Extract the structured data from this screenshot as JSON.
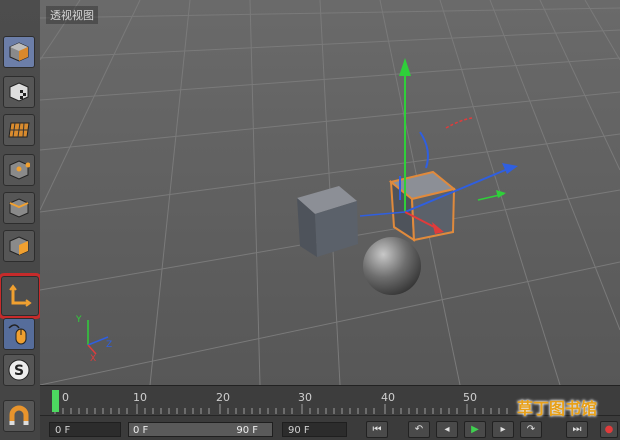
{
  "viewport": {
    "title": "透视视图"
  },
  "timeline": {
    "ticks": [
      "0",
      "10",
      "20",
      "30",
      "40",
      "50"
    ]
  },
  "controls": {
    "start_frame": "0 F",
    "range_start": "0 F",
    "range_end": "90 F",
    "end_frame": "90 F"
  },
  "gizmo": {
    "x_label": "X",
    "y_label": "Y",
    "z_label": "Z"
  },
  "watermark": {
    "text": "草丁图书馆"
  },
  "colors": {
    "selection": "#e08a3c",
    "x_axis": "#e03b3b",
    "y_axis": "#2fcf3a",
    "z_axis": "#2f5fe0",
    "highlight_box": "#c62b2b"
  }
}
